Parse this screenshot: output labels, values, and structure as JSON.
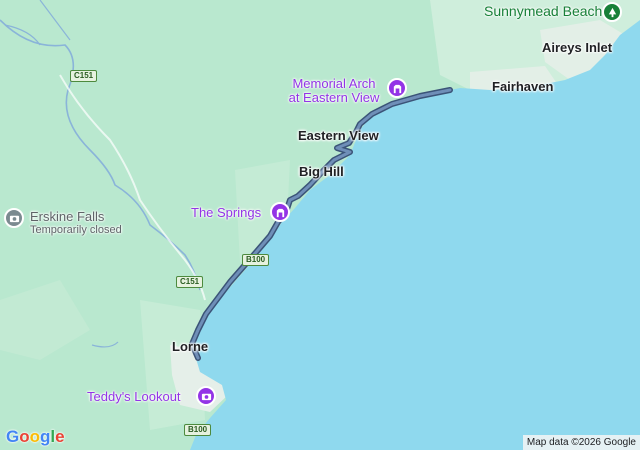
{
  "map": {
    "places": {
      "sunnymead_beach": "Sunnymead Beach",
      "aireys_inlet": "Aireys Inlet",
      "fairhaven": "Fairhaven",
      "eastern_view": "Eastern View",
      "big_hill": "Big Hill",
      "lorne": "Lorne"
    },
    "pois": {
      "memorial_arch": "Memorial Arch\nat Eastern View",
      "the_springs": "The Springs",
      "teddys_lookout": "Teddy's Lookout",
      "erskine_falls": "Erskine Falls",
      "erskine_falls_status": "Temporarily closed"
    },
    "roads": {
      "c151_north": "C151",
      "c151_south": "C151",
      "b100_mid": "B100",
      "b100_south": "B100"
    },
    "attribution": "Map data ©2026 Google",
    "logo": [
      "G",
      "o",
      "o",
      "g",
      "l",
      "e"
    ],
    "colors": {
      "water": "#8fd9ee",
      "land": "#b9e8cf",
      "land_light": "#d4f0df",
      "river": "#8ab4d9",
      "route": "#5b7da8",
      "route_outline": "#3b5478",
      "poi_purple": "#9334e6",
      "poi_green": "#188038"
    },
    "icons": {
      "memorial_arch_pin": "monument-icon",
      "the_springs_pin": "monument-icon",
      "teddys_lookout_pin": "camera-icon",
      "sunnymead_beach_pin": "tree-icon",
      "erskine_falls_pin": "camera-icon"
    }
  }
}
